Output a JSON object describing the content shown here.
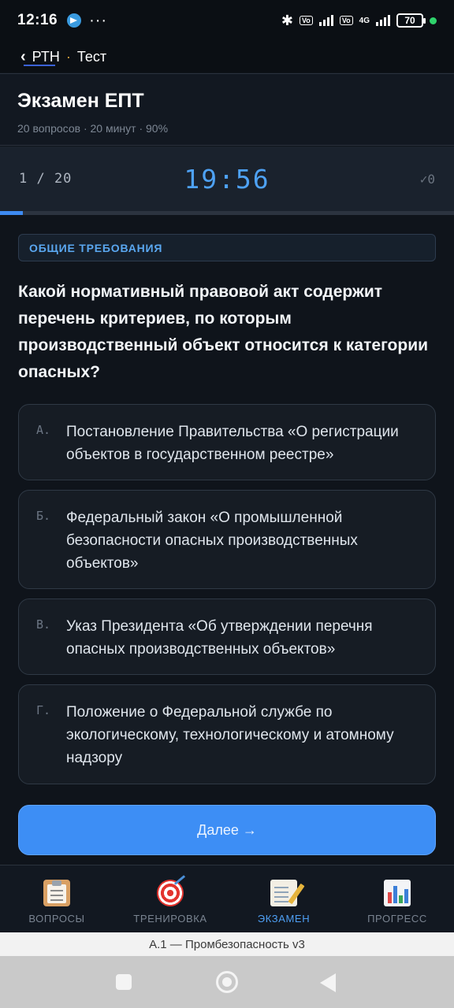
{
  "statusbar": {
    "time": "12:16",
    "more": "···",
    "battery": "70",
    "lte1": "Vo LTE",
    "lte2": "Vo LTE",
    "net": "4G"
  },
  "breadcrumb": {
    "back_icon": "‹",
    "parent": "РТН",
    "separator": "·",
    "current": "Тест"
  },
  "header": {
    "title": "Экзамен ЕПТ",
    "meta": "20 вопросов · 20 минут · 90%"
  },
  "progress": {
    "counter": "1 / 20",
    "timer": "19:56",
    "correct": "✓0",
    "fraction": 0.05
  },
  "question": {
    "category": "ОБЩИЕ ТРЕБОВАНИЯ",
    "text": "Какой нормативный правовой акт содержит перечень критериев, по которым производственный объект относится к категории опасных?",
    "options": [
      {
        "letter": "А.",
        "text": "Постановление Правительства «О регистрации объектов в государственном реестре»"
      },
      {
        "letter": "Б.",
        "text": "Федеральный закон «О промышленной безопасности опасных производственных объектов»"
      },
      {
        "letter": "В.",
        "text": "Указ Президента «Об утверждении перечня опасных производственных объектов»"
      },
      {
        "letter": "Г.",
        "text": "Положение о Федеральной службе по экологическому, технологическому и атомному надзору"
      }
    ]
  },
  "next_button": "Далее →",
  "bottom_nav": {
    "items": [
      {
        "label": "ВОПРОСЫ",
        "icon": "clipboard-icon"
      },
      {
        "label": "ТРЕНИРОВКА",
        "icon": "target-icon"
      },
      {
        "label": "ЭКЗАМЕН",
        "icon": "memo-icon",
        "active": true
      },
      {
        "label": "ПРОГРЕСС",
        "icon": "bar-chart-icon"
      }
    ]
  },
  "footer_strip": "А.1 — Промбезопасность v3",
  "colors": {
    "accent": "#3d8ef5",
    "timer": "#4ea2f5",
    "background": "#0f141b"
  }
}
